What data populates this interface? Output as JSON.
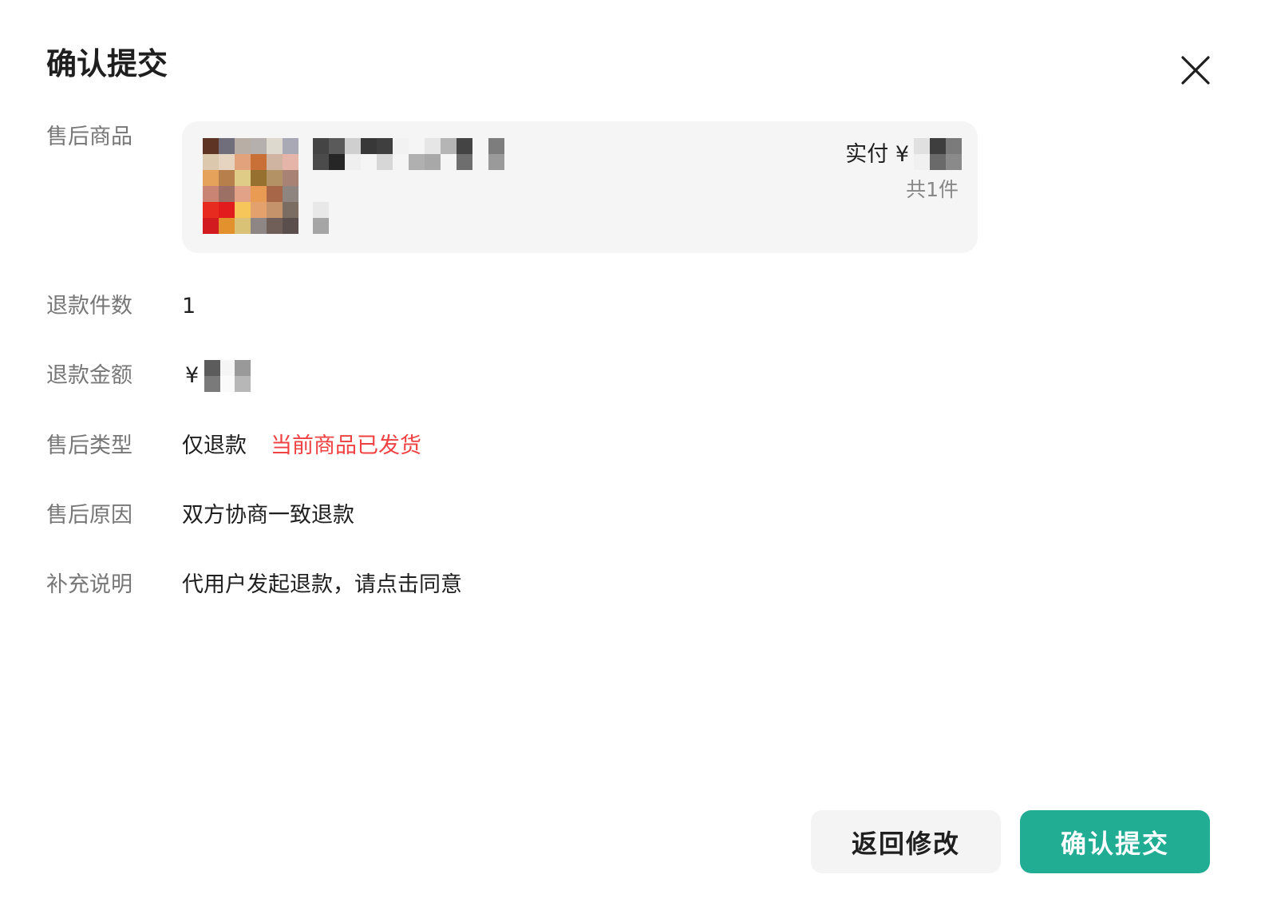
{
  "dialog": {
    "title": "确认提交",
    "close_icon": "close-icon"
  },
  "product": {
    "label": "售后商品",
    "paid_prefix": "实付 ¥",
    "count_text": "共1件"
  },
  "rows": {
    "refund_qty": {
      "label": "退款件数",
      "value": "1"
    },
    "refund_amount": {
      "label": "退款金额",
      "currency": "¥"
    },
    "aftersale_type": {
      "label": "售后类型",
      "value": "仅退款",
      "notice": "当前商品已发货"
    },
    "aftersale_reason": {
      "label": "售后原因",
      "value": "双方协商一致退款"
    },
    "note": {
      "label": "补充说明",
      "value": "代用户发起退款，请点击同意"
    }
  },
  "buttons": {
    "back_label": "返回修改",
    "submit_label": "确认提交"
  },
  "colors": {
    "accent": "#20ad94",
    "warning": "#f04142",
    "label": "#777777",
    "card_bg": "#f5f5f5"
  }
}
